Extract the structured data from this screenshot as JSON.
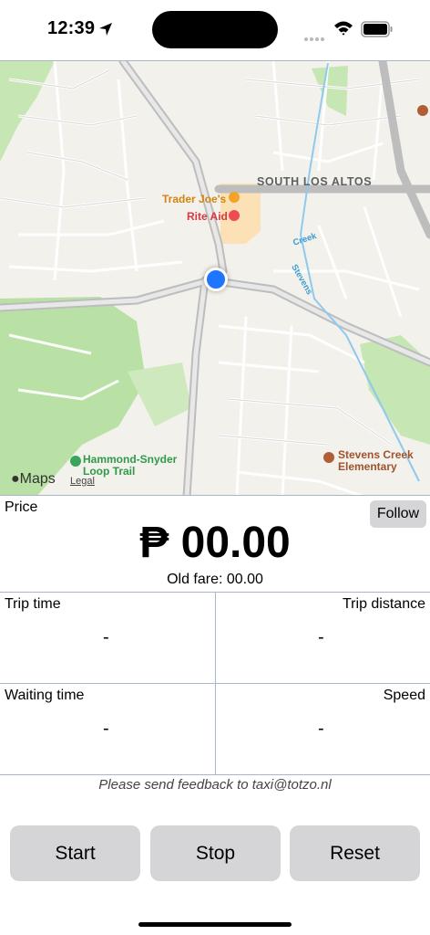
{
  "status_bar": {
    "time": "12:39",
    "icons": [
      "location-arrow-icon",
      "wifi-icon",
      "battery-icon"
    ]
  },
  "map": {
    "area_label": "SOUTH LOS ALTOS",
    "poi_trader_joes": "Trader Joe's",
    "poi_rite_aid": "Rite Aid",
    "poi_trail": "Hammond-Snyder Loop Trail",
    "poi_school": "Stevens Creek Elementary",
    "creek_label": "Creek",
    "creek_label_2": "Stevens",
    "brand": "Maps",
    "legal": "Legal"
  },
  "price": {
    "label": "Price",
    "follow_label": "Follow",
    "value": "₱ 00.00",
    "old_fare": "Old fare: 00.00"
  },
  "stats": {
    "trip_time_label": "Trip time",
    "trip_time_value": "-",
    "trip_distance_label": "Trip distance",
    "trip_distance_value": "-",
    "waiting_time_label": "Waiting time",
    "waiting_time_value": "-",
    "speed_label": "Speed",
    "speed_value": "-"
  },
  "feedback": "Please send feedback to taxi@totzo.nl",
  "buttons": {
    "start": "Start",
    "stop": "Stop",
    "reset": "Reset"
  },
  "colors": {
    "accent_blue": "#1f75fe",
    "button_gray": "#d5d5d7",
    "divider": "#a9b6c6"
  }
}
